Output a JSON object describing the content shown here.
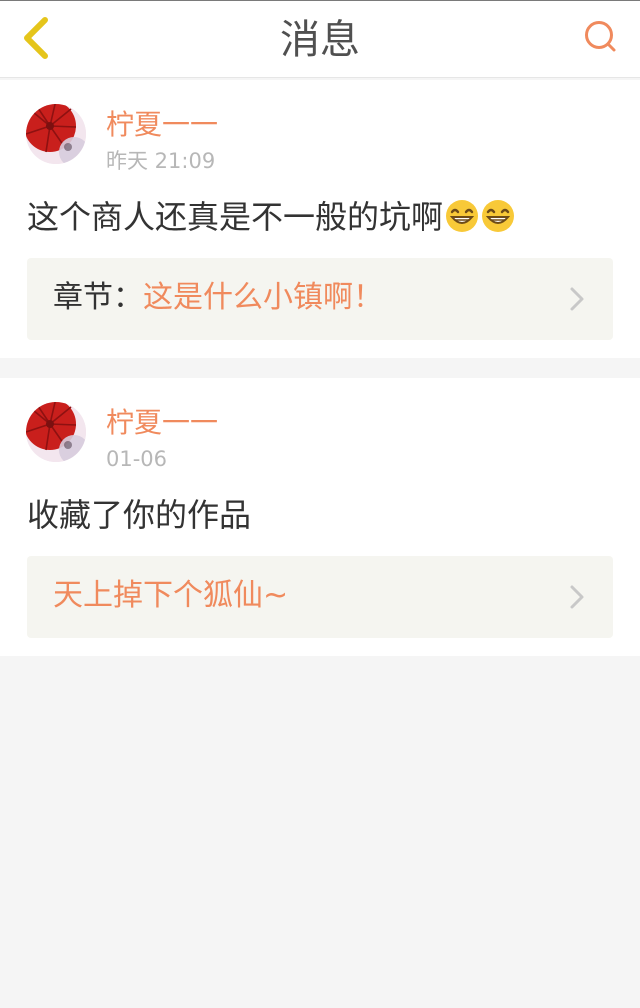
{
  "header": {
    "title": "消息",
    "back_icon": "chevron-left-icon",
    "search_icon": "search-icon",
    "accent_color": "#e5c51b",
    "search_color": "#f08a5d"
  },
  "messages": [
    {
      "user": "柠夏一一",
      "time": "昨天 21:09",
      "text": "这个商人还真是不一般的坑啊",
      "emoji": [
        "laughing-emoji",
        "laughing-emoji"
      ],
      "reference": {
        "label": "章节：",
        "title": "这是什么小镇啊！"
      }
    },
    {
      "user": "柠夏一一",
      "time": "01-06",
      "text": "收藏了你的作品",
      "reference": {
        "label": "",
        "title": "天上掉下个狐仙~"
      }
    }
  ],
  "colors": {
    "username": "#f08a5d",
    "time": "#b7b7b7",
    "content": "#333333",
    "reference_bg": "#f5f5f0"
  }
}
